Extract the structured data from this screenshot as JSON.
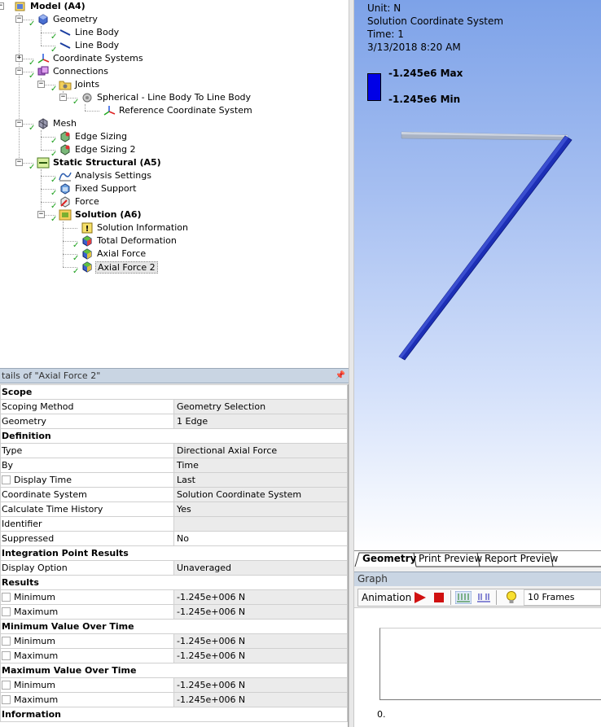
{
  "tree": {
    "model": "Model (A4)",
    "geometry": "Geometry",
    "line_body_1": "Line Body",
    "line_body_2": "Line Body",
    "coordinate_systems": "Coordinate Systems",
    "connections": "Connections",
    "joints": "Joints",
    "spherical_joint": "Spherical - Line Body To Line Body",
    "reference_cs": "Reference Coordinate System",
    "mesh": "Mesh",
    "edge_sizing_1": "Edge Sizing",
    "edge_sizing_2": "Edge Sizing 2",
    "static_structural": "Static Structural (A5)",
    "analysis_settings": "Analysis Settings",
    "fixed_support": "Fixed Support",
    "force": "Force",
    "solution": "Solution (A6)",
    "solution_information": "Solution Information",
    "total_deformation": "Total Deformation",
    "axial_force_1": "Axial Force",
    "axial_force_2": "Axial Force 2"
  },
  "details": {
    "title": "tails of \"Axial Force 2\"",
    "pin": "↑",
    "rows": [
      {
        "type": "section",
        "label": "Scope"
      },
      {
        "label": "Scoping Method",
        "value": "Geometry Selection"
      },
      {
        "label": "Geometry",
        "value": "1 Edge"
      },
      {
        "type": "section",
        "label": "Definition"
      },
      {
        "label": "Type",
        "value": "Directional Axial Force"
      },
      {
        "label": "By",
        "value": "Time"
      },
      {
        "label": "Display Time",
        "value": "Last",
        "checkbox": true
      },
      {
        "label": "Coordinate System",
        "value": "Solution Coordinate System"
      },
      {
        "label": "Calculate Time History",
        "value": "Yes"
      },
      {
        "label": "Identifier",
        "value": ""
      },
      {
        "label": "Suppressed",
        "value": "No",
        "white": true
      },
      {
        "type": "section",
        "label": "Integration Point Results"
      },
      {
        "label": "Display Option",
        "value": "Unaveraged"
      },
      {
        "type": "section",
        "label": "Results"
      },
      {
        "label": "Minimum",
        "value": "-1.245e+006 N",
        "checkbox": true
      },
      {
        "label": "Maximum",
        "value": "-1.245e+006 N",
        "checkbox": true
      },
      {
        "type": "section",
        "label": "Minimum Value Over Time"
      },
      {
        "label": "Minimum",
        "value": "-1.245e+006 N",
        "checkbox": true
      },
      {
        "label": "Maximum",
        "value": "-1.245e+006 N",
        "checkbox": true
      },
      {
        "type": "section",
        "label": "Maximum Value Over Time"
      },
      {
        "label": "Minimum",
        "value": "-1.245e+006 N",
        "checkbox": true
      },
      {
        "label": "Maximum",
        "value": "-1.245e+006 N",
        "checkbox": true
      },
      {
        "type": "section",
        "label": "Information"
      }
    ]
  },
  "viewport": {
    "unit": "Unit: N",
    "coord_system": "Solution Coordinate System",
    "time": "Time: 1",
    "date": "3/13/2018 8:20 AM",
    "legend_max": "-1.245e6 Max",
    "legend_min": "-1.245e6 Min",
    "legend_color": "#0000e6"
  },
  "tabs": {
    "geometry": "Geometry",
    "print_preview": "Print Preview",
    "report_preview": "Report Preview"
  },
  "graph": {
    "title": "Graph",
    "animation": "Animation",
    "frames": "10 Frames",
    "axis_zero": "0."
  }
}
